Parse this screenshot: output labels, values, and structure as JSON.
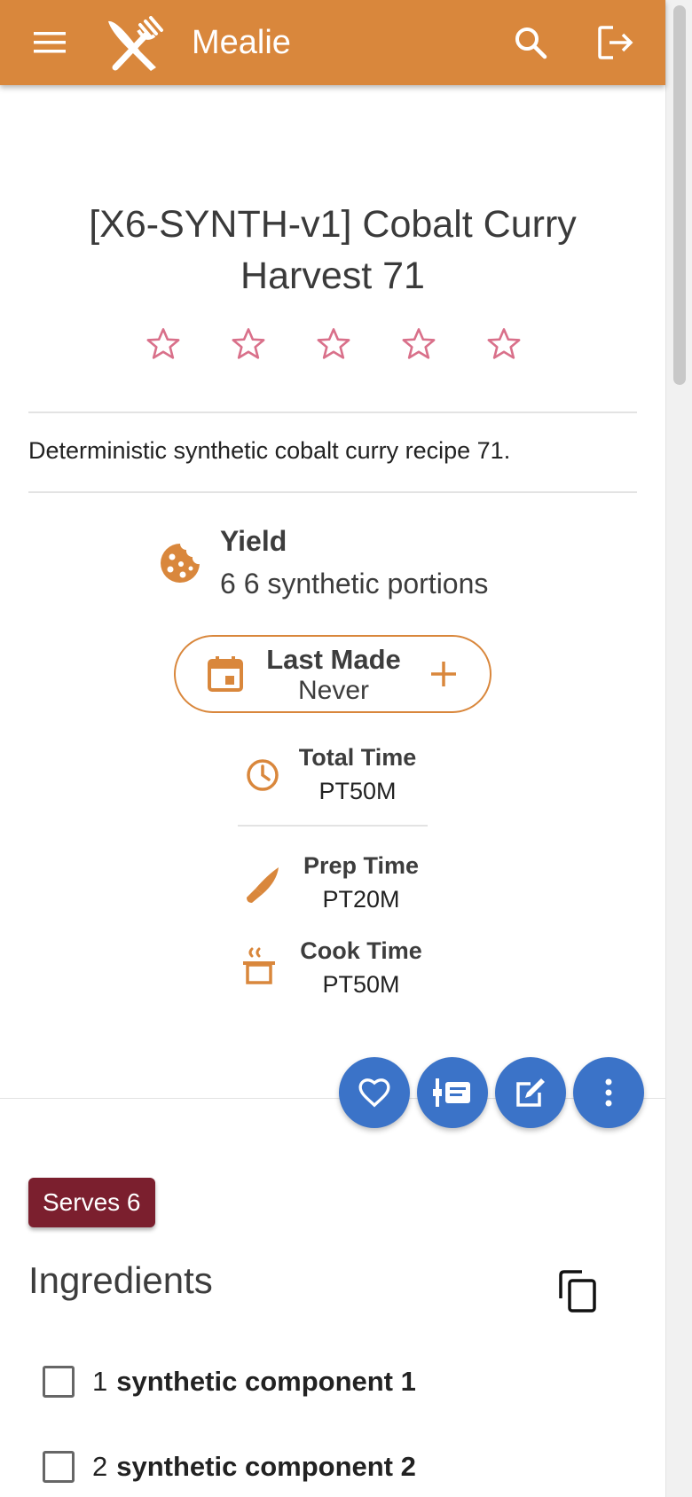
{
  "app": {
    "title": "Mealie"
  },
  "recipe": {
    "title": "[X6-SYNTH-v1] Cobalt Curry Harvest 71",
    "rating_value": 0,
    "rating_max": 5,
    "description": "Deterministic synthetic cobalt curry recipe 71.",
    "yield_label": "Yield",
    "yield_value": "6 6 synthetic portions",
    "last_made_label": "Last Made",
    "last_made_value": "Never",
    "total_time_label": "Total Time",
    "total_time_value": "PT50M",
    "prep_time_label": "Prep Time",
    "prep_time_value": "PT20M",
    "cook_time_label": "Cook Time",
    "cook_time_value": "PT50M",
    "serves_label": "Serves 6"
  },
  "ingredients": {
    "title": "Ingredients",
    "items": [
      {
        "qty": "1",
        "name": "synthetic component 1"
      },
      {
        "qty": "2",
        "name": "synthetic component 2"
      }
    ]
  },
  "colors": {
    "app_bar": "#d9873c",
    "accent": "#d9873c",
    "fab": "#3b73c8",
    "star": "#d9708a",
    "serves_chip": "#7b1f2e"
  },
  "icons": {
    "menu": "menu-icon",
    "logo": "fork-knife-icon",
    "search": "search-icon",
    "logout": "logout-icon",
    "yield": "cookie-icon",
    "calendar": "calendar-icon",
    "plus": "plus-icon",
    "total_time": "clock-icon",
    "prep_time": "knife-icon",
    "cook_time": "pot-steam-icon",
    "favorite": "heart-outline-icon",
    "timeline": "timeline-icon",
    "edit": "edit-icon",
    "more": "dots-vertical-icon",
    "copy": "copy-icon"
  }
}
